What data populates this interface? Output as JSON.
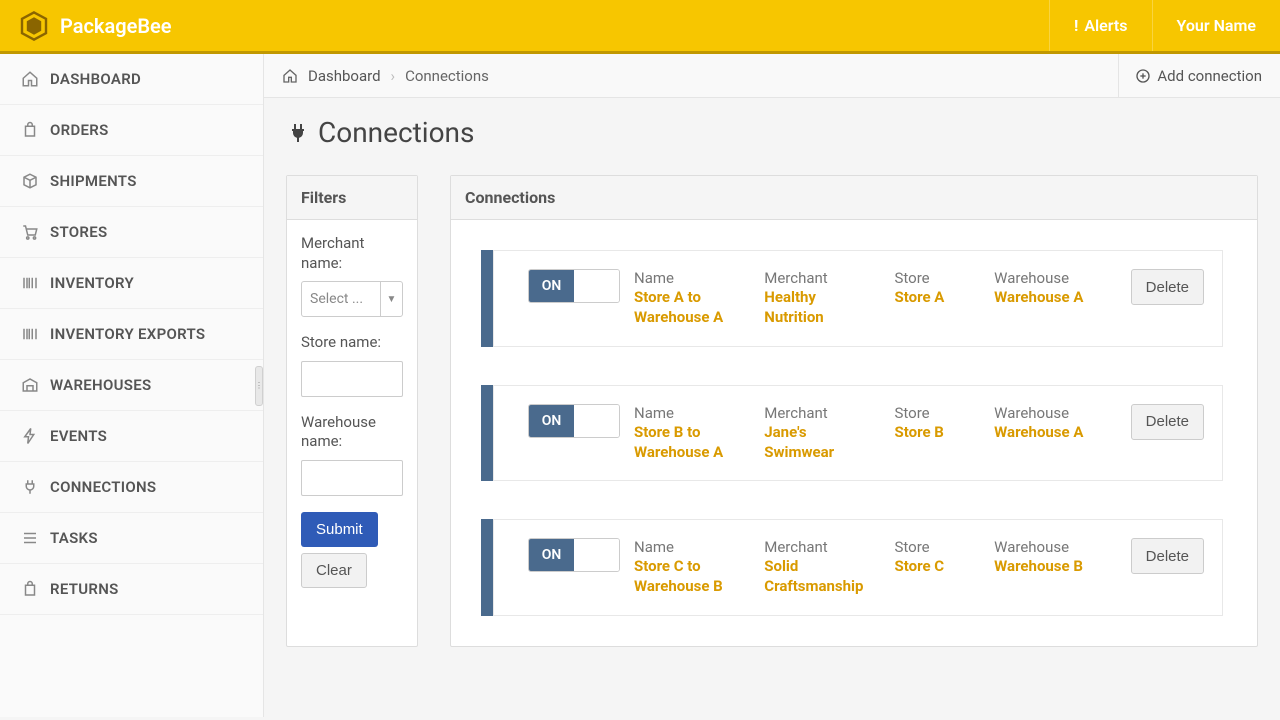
{
  "brand": "PackageBee",
  "header": {
    "alerts_label": "Alerts",
    "user_name": "Your Name"
  },
  "nav": [
    {
      "label": "DASHBOARD",
      "icon": "home"
    },
    {
      "label": "ORDERS",
      "icon": "bag"
    },
    {
      "label": "SHIPMENTS",
      "icon": "package"
    },
    {
      "label": "STORES",
      "icon": "cart"
    },
    {
      "label": "INVENTORY",
      "icon": "barcode"
    },
    {
      "label": "INVENTORY EXPORTS",
      "icon": "barcode"
    },
    {
      "label": "WAREHOUSES",
      "icon": "warehouse"
    },
    {
      "label": "EVENTS",
      "icon": "bolt"
    },
    {
      "label": "CONNECTIONS",
      "icon": "plug"
    },
    {
      "label": "TASKS",
      "icon": "list"
    },
    {
      "label": "RETURNS",
      "icon": "bag"
    }
  ],
  "breadcrumb": {
    "dashboard": "Dashboard",
    "current": "Connections"
  },
  "actions": {
    "add_connection": "Add connection"
  },
  "page": {
    "title": "Connections"
  },
  "filters": {
    "panel_title": "Filters",
    "merchant_label": "Merchant name:",
    "merchant_placeholder": "Select ...",
    "store_label": "Store name:",
    "store_value": "",
    "warehouse_label": "Warehouse name:",
    "warehouse_value": "",
    "submit": "Submit",
    "clear": "Clear"
  },
  "connections": {
    "panel_title": "Connections",
    "columns": {
      "name": "Name",
      "merchant": "Merchant",
      "store": "Store",
      "warehouse": "Warehouse"
    },
    "toggle_on": "ON",
    "delete_label": "Delete",
    "rows": [
      {
        "name": "Store A to Warehouse A",
        "merchant": "Healthy Nutrition",
        "store": "Store A",
        "warehouse": "Warehouse A"
      },
      {
        "name": "Store B to Warehouse A",
        "merchant": "Jane's Swimwear",
        "store": "Store B",
        "warehouse": "Warehouse A"
      },
      {
        "name": "Store C to Warehouse B",
        "merchant": "Solid Craftsmanship",
        "store": "Store C",
        "warehouse": "Warehouse B"
      }
    ]
  }
}
